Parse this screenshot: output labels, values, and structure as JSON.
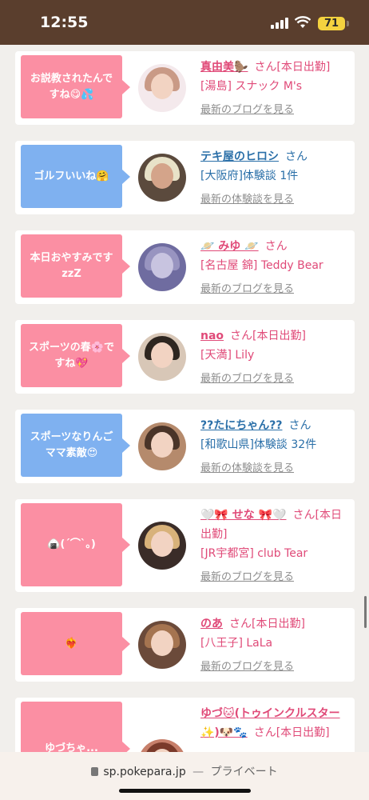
{
  "status_bar": {
    "time": "12:55",
    "battery": "71"
  },
  "browser": {
    "url": "sp.pokepara.jp",
    "separator": "—",
    "private_label": "プライベート"
  },
  "colors": {
    "pink_bubble": "#fb8fa3",
    "blue_bubble": "#7fb1f0",
    "pink_text": "#e04a78",
    "blue_text": "#2a6fa8"
  },
  "feed": [
    {
      "bubble": "お説教されたんで\nすね😋💦",
      "bubble_color": "pink",
      "name": "真由美🦫",
      "suffix": "さん[本日出勤]",
      "shop": "[湯島] スナック M's",
      "more": "最新のブログを見る",
      "theme": "pink",
      "avatar": "woman-pink-avatar"
    },
    {
      "bubble": "ゴルフいいね🤗",
      "bubble_color": "blue",
      "name": "テキ屋のヒロシ",
      "suffix": "さん",
      "shop": "[大阪府]体験談 1件",
      "more": "最新の体験談を見る",
      "theme": "blue",
      "avatar": "man-sunglasses-avatar"
    },
    {
      "bubble": "本日おやすみです\nzzZ",
      "bubble_color": "pink",
      "name": "🪐 みゆ 🪐",
      "suffix": "さん",
      "shop": "[名古屋 錦] Teddy Bear",
      "more": "最新のブログを見る",
      "theme": "pink",
      "avatar": "blurred-avatar"
    },
    {
      "bubble": "スポーツの春🌸で\nすね💖",
      "bubble_color": "pink",
      "name": "nao",
      "suffix": "さん[本日出勤]",
      "shop": "[天満] Lily",
      "more": "最新のブログを見る",
      "theme": "pink",
      "avatar": "woman-bottle-avatar"
    },
    {
      "bubble": "スポーツなりんご\nママ素敵😍",
      "bubble_color": "blue",
      "name": "??たにちゃん??",
      "suffix": "さん",
      "shop": "[和歌山県]体験談 32件",
      "more": "最新の体験談を見る",
      "theme": "blue",
      "avatar": "couple-avatar"
    },
    {
      "bubble": "🍙(´⌒`｡)",
      "bubble_color": "pink",
      "name": "🤍🎀 せな 🎀🤍",
      "suffix": "さん[本日出勤]",
      "shop": "[JR宇都宮] club Tear",
      "more": "最新のブログを見る",
      "theme": "pink",
      "avatar": "woman-blonde-avatar"
    },
    {
      "bubble": "❤️‍🔥",
      "bubble_color": "pink",
      "name": "のあ",
      "suffix": "さん[本日出勤]",
      "shop": "[八王子] LaLa",
      "more": "最新のブログを見る",
      "theme": "pink",
      "avatar": "woman-dog-filter-avatar"
    },
    {
      "bubble": "ゆづちゃ...",
      "bubble_color": "pink",
      "name": "ゆづ🐱(トゥインクルスター✨)🐶🐾",
      "suffix": "さん[本日出勤]",
      "shop": "",
      "more": "",
      "theme": "pink",
      "avatar": "woman-avatar"
    }
  ]
}
